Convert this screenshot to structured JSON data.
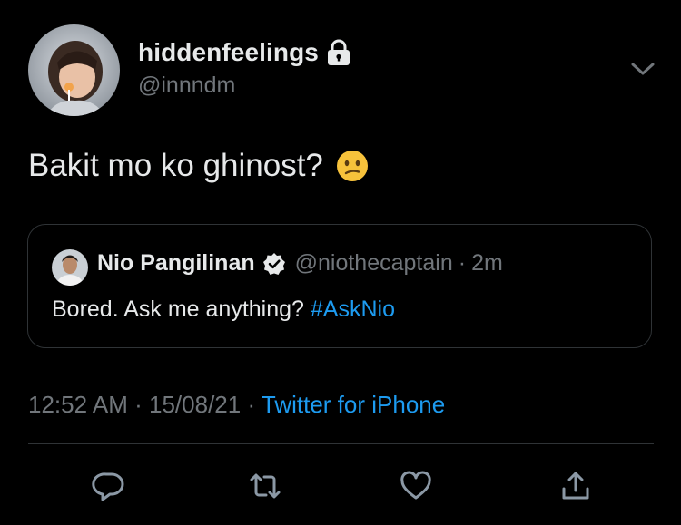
{
  "author": {
    "display_name": "hiddenfeelings",
    "handle": "@innndm",
    "protected_icon": "lock-icon",
    "avatar_icon": "avatar"
  },
  "tweet": {
    "text": "Bakit mo ko ghinost?",
    "emoji_icon": "confused-face-emoji",
    "time": "12:52 AM",
    "date": "15/08/21",
    "separator": "·",
    "source": "Twitter for iPhone"
  },
  "quoted_tweet": {
    "display_name": "Nio Pangilinan",
    "verified_icon": "verified-badge-icon",
    "handle": "@niothecaptain",
    "separator": "·",
    "time": "2m",
    "text": "Bored. Ask me anything?",
    "hashtag": "#AskNio"
  },
  "actions": [
    {
      "icon": "reply-icon"
    },
    {
      "icon": "retweet-icon"
    },
    {
      "icon": "like-icon"
    },
    {
      "icon": "share-icon"
    }
  ],
  "colors": {
    "background": "#000000",
    "primary_text": "#e7e9ea",
    "secondary_text": "#71767b",
    "accent": "#1d9bf0",
    "border": "#2f3336",
    "emoji": "#f7c23b"
  }
}
